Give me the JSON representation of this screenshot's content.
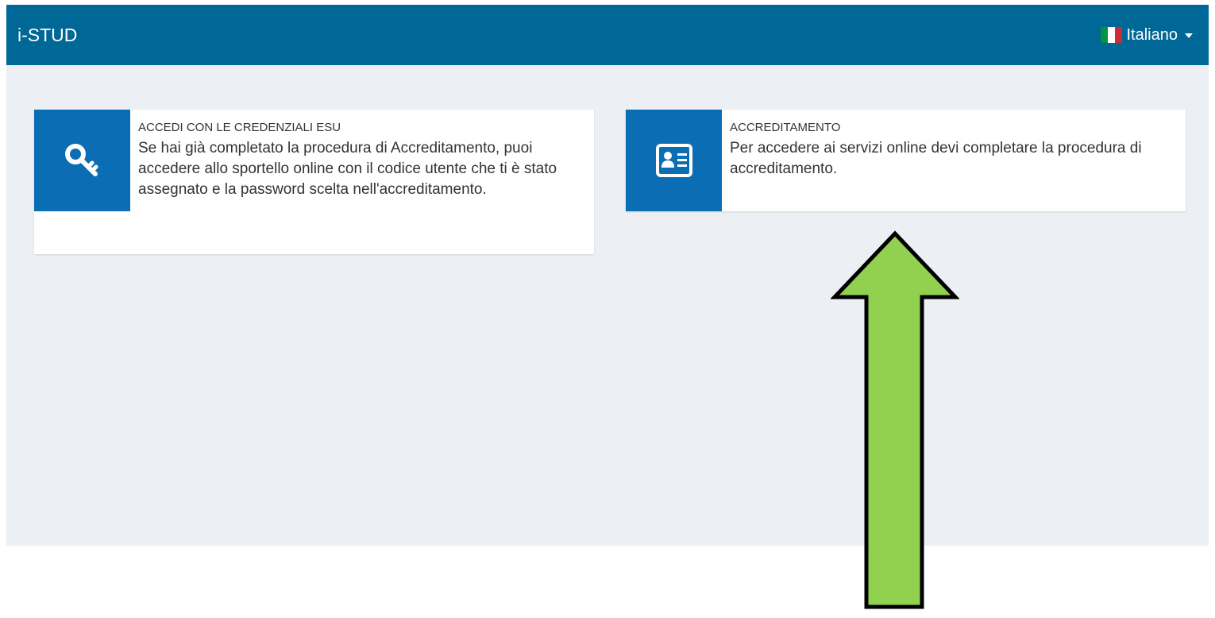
{
  "header": {
    "brand": "i-STUD",
    "language": {
      "label": "Italiano",
      "flag_colors": [
        "#009246",
        "#ffffff",
        "#ce2b37"
      ]
    }
  },
  "cards": [
    {
      "title": "ACCEDI CON LE CREDENZIALI ESU",
      "text": "Se hai già completato la procedura di Accreditamento, puoi accedere allo sportello online con il codice utente che ti è stato assegnato e la password scelta nell'accreditamento.",
      "icon": "key-icon"
    },
    {
      "title": "ACCREDITAMENTO",
      "text": "Per accedere ai servizi online devi completare la procedura di accreditamento.",
      "icon": "id-card-icon"
    }
  ],
  "annotation": {
    "arrow_color": "#92d050",
    "arrow_direction": "up"
  },
  "colors": {
    "header_bg": "#006896",
    "tile_bg": "#0b6eb4",
    "page_bg": "#eceff4"
  }
}
